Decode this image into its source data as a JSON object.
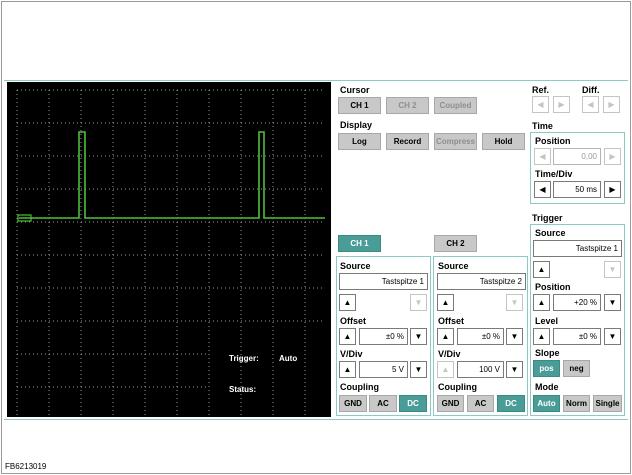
{
  "scope": {
    "trigger_label": "Trigger:",
    "trigger_value": "Auto",
    "status_label": "Status:",
    "status_value": ""
  },
  "cursor": {
    "title": "Cursor",
    "ch1": "CH 1",
    "ch2": "CH 2",
    "coupled": "Coupled"
  },
  "display": {
    "title": "Display",
    "log": "Log",
    "record": "Record",
    "compress": "Compress",
    "hold": "Hold"
  },
  "ref": {
    "title": "Ref."
  },
  "diff": {
    "title": "Diff."
  },
  "time": {
    "title": "Time",
    "position_label": "Position",
    "position_value": "0,00",
    "timediv_label": "Time/Div",
    "timediv_value": "50 ms"
  },
  "tabs": {
    "ch1": "CH 1",
    "ch2": "CH 2"
  },
  "ch1": {
    "source_label": "Source",
    "source_value": "Tastspitze 1",
    "offset_label": "Offset",
    "offset_value": "±0 %",
    "vdiv_label": "V/Div",
    "vdiv_value": "5 V",
    "coupling_label": "Coupling",
    "gnd": "GND",
    "ac": "AC",
    "dc": "DC"
  },
  "ch2": {
    "source_label": "Source",
    "source_value": "Tastspitze 2",
    "offset_label": "Offset",
    "offset_value": "±0 %",
    "vdiv_label": "V/Div",
    "vdiv_value": "100 V",
    "coupling_label": "Coupling",
    "gnd": "GND",
    "ac": "AC",
    "dc": "DC"
  },
  "trigger": {
    "title": "Trigger",
    "source_label": "Source",
    "source_value": "Tastspitze 1",
    "position_label": "Position",
    "position_value": "+20 %",
    "level_label": "Level",
    "level_value": "±0 %",
    "slope_label": "Slope",
    "pos": "pos",
    "neg": "neg",
    "mode_label": "Mode",
    "auto": "Auto",
    "norm": "Norm",
    "single": "Single"
  },
  "footer": "FB6213019",
  "icons": {
    "up": "▲",
    "down": "▼",
    "left": "◀",
    "right": "▶"
  },
  "colors": {
    "accent": "#4a9d97",
    "trace": "#4fbf3a",
    "screen": "#000000"
  }
}
